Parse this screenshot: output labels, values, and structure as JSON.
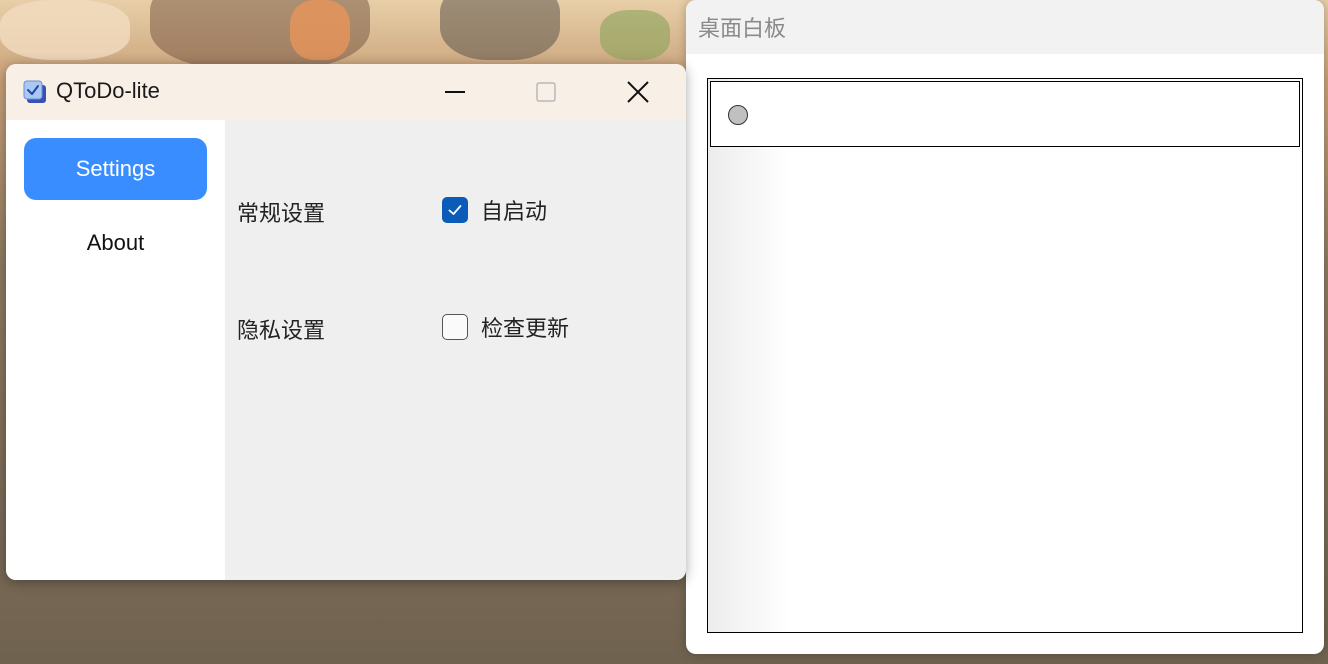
{
  "whiteboard": {
    "title": "桌面白板"
  },
  "app": {
    "title": "QToDo-lite",
    "sidebar": {
      "items": [
        {
          "label": "Settings",
          "active": true
        },
        {
          "label": "About",
          "active": false
        }
      ]
    },
    "settings": {
      "general": {
        "section_label": "常规设置",
        "option_label": "自启动",
        "checked": true
      },
      "privacy": {
        "section_label": "隐私设置",
        "option_label": "检查更新",
        "checked": false
      }
    }
  },
  "colors": {
    "accent": "#3a8dff",
    "checkbox_checked": "#0b5cb8",
    "titlebar": "#f8efe6"
  }
}
